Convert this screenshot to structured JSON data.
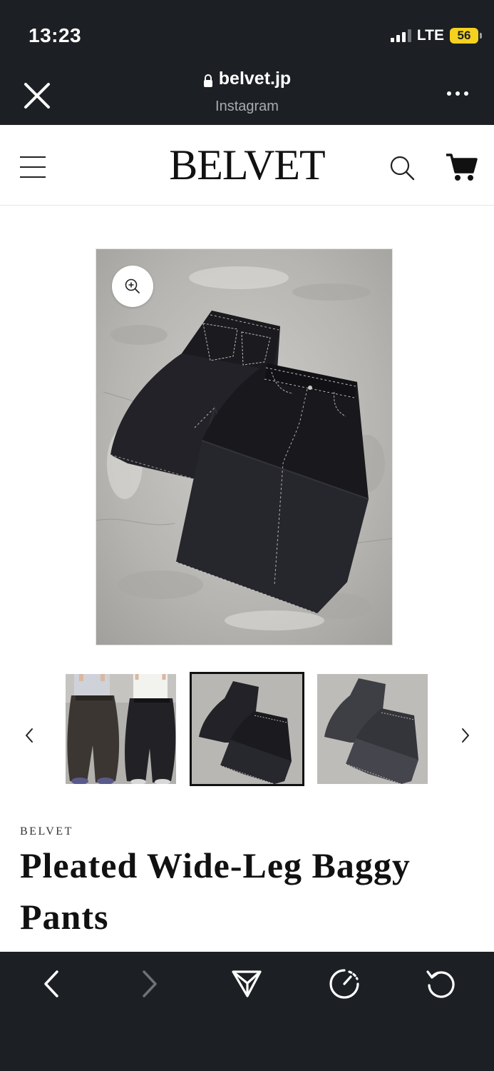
{
  "status_bar": {
    "time": "13:23",
    "network": "LTE",
    "battery": "56",
    "battery_color": "#f4d21f"
  },
  "browser": {
    "url": "belvet.jp",
    "source": "Instagram",
    "icons": {
      "close": "close-icon",
      "lock": "lock-icon",
      "more": "more-icon"
    }
  },
  "site_header": {
    "logo": "BELVET",
    "icons": {
      "menu": "hamburger-menu-icon",
      "search": "search-icon",
      "cart": "cart-icon"
    }
  },
  "gallery": {
    "zoom_icon": "zoom-in-icon",
    "selected_thumbnail": 2,
    "thumbnail_count": 3
  },
  "product": {
    "vendor": "BELVET",
    "title": "Pleated Wide-Leg Baggy Pants"
  },
  "toolbar": {
    "icons": [
      "back-arrow-icon",
      "forward-arrow-icon",
      "share-icon",
      "speed-icon",
      "reload-icon"
    ]
  },
  "colors": {
    "chrome_dark": "#1c1f23",
    "text": "#111111",
    "denim_black": "#1d1d22"
  }
}
